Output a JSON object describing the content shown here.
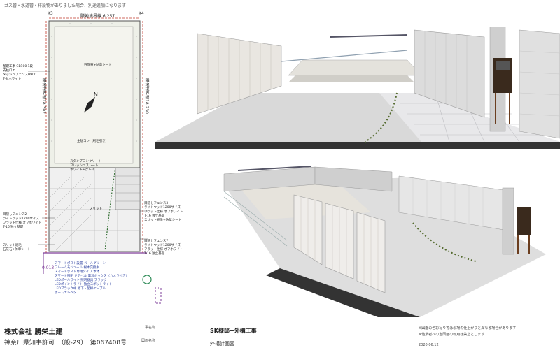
{
  "top_note": "ガス管・水道管・排設物がありました場合、別途追加になります",
  "plan": {
    "boundary_top": "隣地境界線 6.257",
    "boundary_right": "隣地境界線18.230",
    "boundary_left": "隣地境界線18.302",
    "k_left": "K3",
    "k_right": "K4",
    "gravel": "石灰石+防草シート",
    "main_cone": "主駐コン（刷毛引き）",
    "stamp_concrete": "スタンプコンクリート\nフレッシュスレート\nホワイト+グレイ",
    "slit": "スリット",
    "note_left_top": "基礎工事 CB100 1段\n支柱ロエ\nメッシュフェンスH900\nT-8 ホワイト",
    "fence_left": "目隠しフェンス2\nライトウッド1200サイズ\nフラット仕様 オフホワイト\nT-16 独立基礎",
    "slit_left": "スリット刷毛\n石灰石+防草シート",
    "fence_right1": "目隠しフェンス3\nライトウッド1200サイズ\nフラット仕様 オフホワイト\nT-16 独立基礎\nスリット刷毛+防草シート",
    "fence_right2": "目隠しフェンス7\nライトウッド1200サイズ\nフラット仕様 オフホワイト\nT-16 独立基礎",
    "blue_notes": "スマートポスト設置 ペールグリーン\nフレームモジュール 樹木交換中\nスマートポスト専用タイプ 本体\nスマート照明 ドアベル 電源ボックス（カメラ付き）\nLEDポールライト 照明器具 ブラック\nLEDポイントライト 独立スポットライト\nLEDブラック中 地下・配線ケーブル\nホームエレベタ",
    "label_0013": "0.013"
  },
  "title_block": {
    "company": "株式会社 勝栄土建",
    "license": "神奈川県知事許可　（般-29）　第067408号",
    "project_label": "工事名称",
    "project_name": "SK様邸−外構工事",
    "drawing_label": "図面名称",
    "drawing_name": "外構計画図",
    "note1": "※図面の色彩写り等は現場の仕上がりと異なる場合があります",
    "note2": "※他業者への当図面の転用は禁止とします",
    "date": "2020.06.12"
  },
  "colors": {
    "plan_border": "#444444",
    "boundary_red": "#c0392b",
    "purple": "#7d3c98",
    "green_circle": "#2e8b57"
  }
}
